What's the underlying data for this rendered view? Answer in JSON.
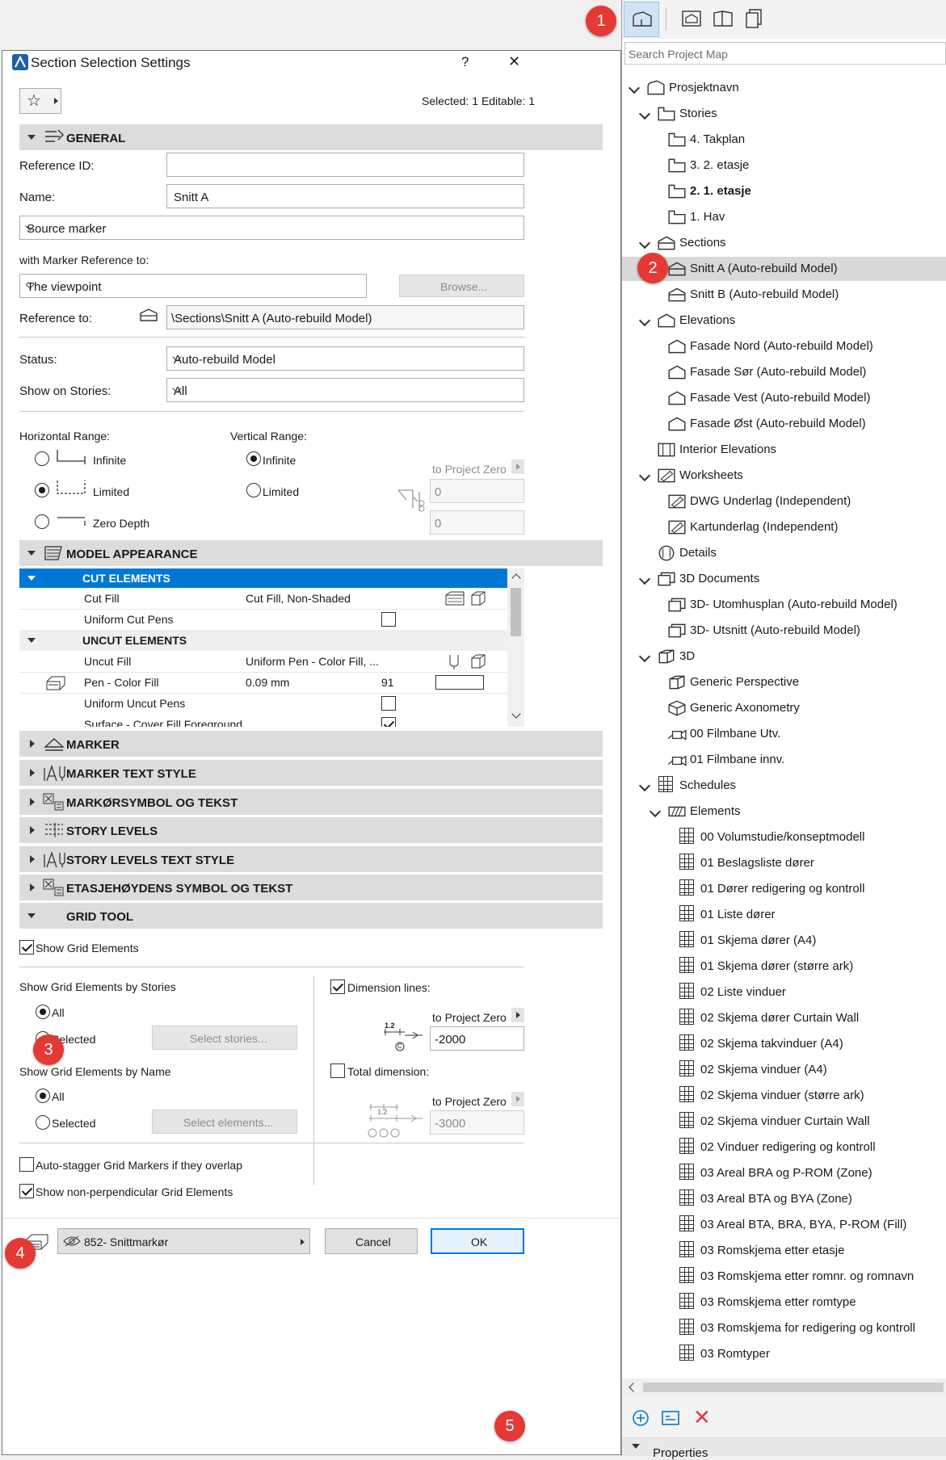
{
  "badges": [
    "1",
    "2",
    "3",
    "4",
    "5"
  ],
  "dialog": {
    "title": "Section Selection Settings",
    "help": "?",
    "close": "✕",
    "selected_info": "Selected: 1 Editable: 1",
    "general": {
      "header": "GENERAL",
      "reference_id_label": "Reference ID:",
      "reference_id_value": "",
      "name_label": "Name:",
      "name_value": "Snitt A",
      "marker_type": "Source marker",
      "marker_ref_label": "with Marker Reference to:",
      "marker_ref_value": "The viewpoint",
      "browse": "Browse...",
      "reference_to_label": "Reference to:",
      "reference_to_value": "\\Sections\\Snitt A (Auto-rebuild Model)",
      "status_label": "Status:",
      "status_value": "Auto-rebuild Model",
      "show_on_stories_label": "Show on Stories:",
      "show_on_stories_value": "All",
      "horizontal_range_label": "Horizontal Range:",
      "h_infinite": "Infinite",
      "h_limited": "Limited",
      "h_zero_depth": "Zero Depth",
      "vertical_range_label": "Vertical Range:",
      "v_infinite": "Infinite",
      "v_limited": "Limited",
      "to_project_zero": "to Project Zero",
      "v_top": "0",
      "v_bottom": "0"
    },
    "model_appearance": {
      "header": "MODEL APPEARANCE",
      "cut_elements": "CUT ELEMENTS",
      "cut_fill_label": "Cut Fill",
      "cut_fill_value": "Cut Fill, Non-Shaded",
      "uniform_cut_pens": "Uniform Cut Pens",
      "uncut_elements": "UNCUT ELEMENTS",
      "uncut_fill_label": "Uncut Fill",
      "uncut_fill_value": "Uniform Pen - Color Fill, ...",
      "pen_color_fill_label": "Pen - Color Fill",
      "pen_color_fill_value": "0.09 mm",
      "pen_number": "91",
      "uniform_uncut_pens": "Uniform Uncut Pens",
      "surface_partial": "Surface - Cover Fill Foreground"
    },
    "collapsed_sections": [
      "MARKER",
      "MARKER TEXT STYLE",
      "MARKØRSYMBOL OG TEKST",
      "STORY LEVELS",
      "STORY LEVELS TEXT STYLE",
      "ETASJEHØYDENS SYMBOL OG TEKST"
    ],
    "grid_tool": {
      "header": "GRID TOOL",
      "show_grid_elements": "Show Grid Elements",
      "by_stories_label": "Show Grid Elements by Stories",
      "all": "All",
      "selected": "Selected",
      "select_stories": "Select stories...",
      "by_name_label": "Show Grid Elements by Name",
      "select_elements": "Select elements...",
      "dimension_lines": "Dimension lines:",
      "to_project_zero": "to Project Zero",
      "dim_value": "-2000",
      "total_dimension": "Total dimension:",
      "total_value": "-3000",
      "auto_stagger": "Auto-stagger Grid Markers if they overlap",
      "non_perpendicular": "Show non-perpendicular Grid Elements",
      "dim_icon_text": "1.2",
      "dim_icon_circle": "C"
    },
    "footer": {
      "favorite": "852- Snittmarkør",
      "cancel": "Cancel",
      "ok": "OK"
    }
  },
  "navigator": {
    "search_placeholder": "Search Project Map",
    "project": "Prosjektnavn",
    "stories": "Stories",
    "story_items": [
      "4. Takplan",
      "3. 2. etasje",
      "2. 1. etasje",
      "1. Hav"
    ],
    "sections": "Sections",
    "section_items": [
      "Snitt A (Auto-rebuild Model)",
      "Snitt B (Auto-rebuild Model)"
    ],
    "elevations": "Elevations",
    "elevation_items": [
      "Fasade Nord (Auto-rebuild Model)",
      "Fasade Sør (Auto-rebuild Model)",
      "Fasade Vest (Auto-rebuild Model)",
      "Fasade Øst (Auto-rebuild Model)"
    ],
    "interior_elevations": "Interior Elevations",
    "worksheets": "Worksheets",
    "worksheet_items": [
      "DWG Underlag (Independent)",
      "Kartunderlag (Independent)"
    ],
    "details": "Details",
    "documents_3d": "3D Documents",
    "documents_3d_items": [
      "3D- Utomhusplan (Auto-rebuild Model)",
      "3D- Utsnitt (Auto-rebuild Model)"
    ],
    "three_d": "3D",
    "three_d_items": [
      "Generic Perspective",
      "Generic Axonometry",
      "00 Filmbane Utv.",
      "01 Filmbane innv."
    ],
    "schedules": "Schedules",
    "elements": "Elements",
    "schedule_items": [
      "00 Volumstudie/konseptmodell",
      "01 Beslagsliste dører",
      "01 Dører redigering og kontroll",
      "01 Liste dører",
      "01 Skjema dører (A4)",
      "01 Skjema dører (større ark)",
      "02 Liste vinduer",
      "02 Skjema dører Curtain Wall",
      "02 Skjema takvinduer (A4)",
      "02 Skjema vinduer (A4)",
      "02 Skjema vinduer (større ark)",
      "02 Skjema vinduer Curtain Wall",
      "02 Vinduer redigering og kontroll",
      "03 Areal BRA og P-ROM (Zone)",
      "03 Areal BTA og BYA (Zone)",
      "03 Areal BTA, BRA, BYA, P-ROM (Fill)",
      "03 Romskjema etter etasje",
      "03 Romskjema etter romnr. og romnavn",
      "03 Romskjema etter romtype",
      "03 Romskjema for redigering og kontroll",
      "03 Romtyper"
    ],
    "properties": "Properties",
    "colors": {
      "selection": "#d9d9d9",
      "accent": "#0078d7",
      "delete": "#e53935"
    }
  }
}
